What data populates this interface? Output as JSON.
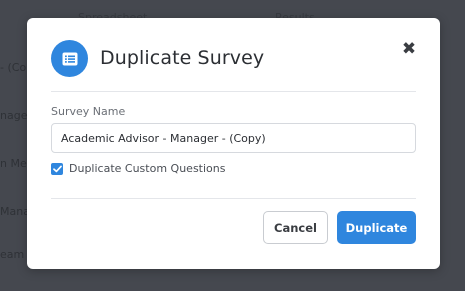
{
  "background": {
    "header_fragments": [
      "Spreadsheet",
      "Results"
    ],
    "row_fragments": [
      "- (Cop",
      "nager",
      "n Me",
      "Manag",
      "eam"
    ]
  },
  "modal": {
    "icon": "survey-list-icon",
    "title": "Duplicate Survey",
    "close_icon": "close-x-icon",
    "close_glyph": "✖",
    "field_label": "Survey Name",
    "survey_name_value": "Academic Advisor - Manager - (Copy)",
    "checkbox_label": "Duplicate Custom Questions",
    "checkbox_checked": true,
    "cancel_label": "Cancel",
    "primary_label": "Duplicate"
  },
  "colors": {
    "accent": "#2f86de",
    "overlay": "#45484f"
  }
}
